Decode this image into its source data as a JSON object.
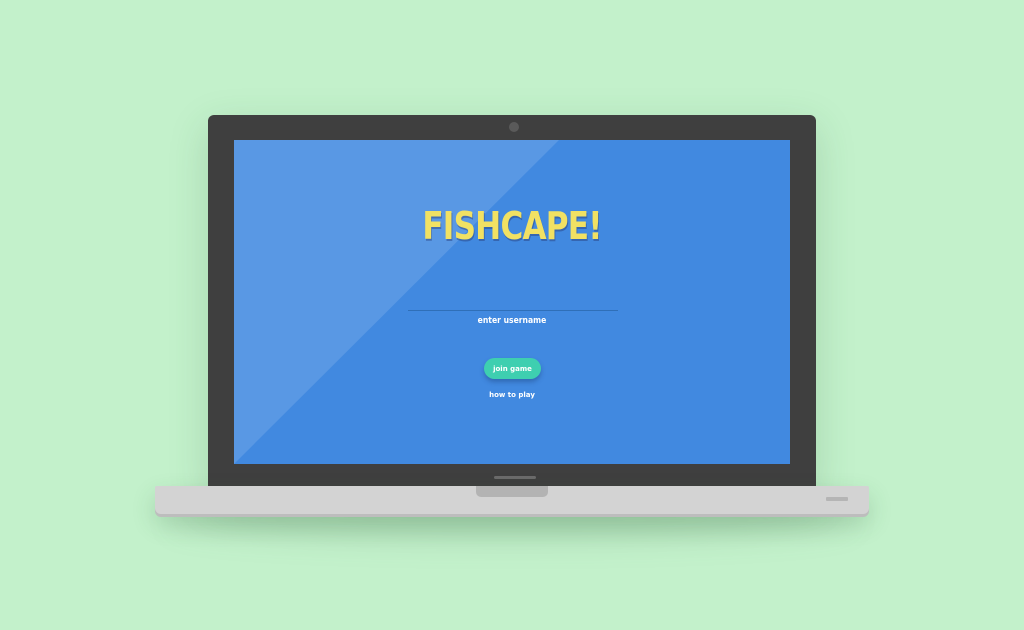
{
  "app": {
    "title": "FISHCAPE!"
  },
  "login": {
    "username_value": "",
    "username_placeholder": "",
    "username_label": "enter username",
    "join_label": "join game",
    "help_label": "how to play"
  },
  "colors": {
    "page_background": "#c3f1cb",
    "screen": "#4189e0",
    "title": "#f1e163",
    "join_button": "#3ecfb0",
    "laptop_bezel": "#3f3f3f",
    "laptop_base": "#d3d3d3"
  }
}
